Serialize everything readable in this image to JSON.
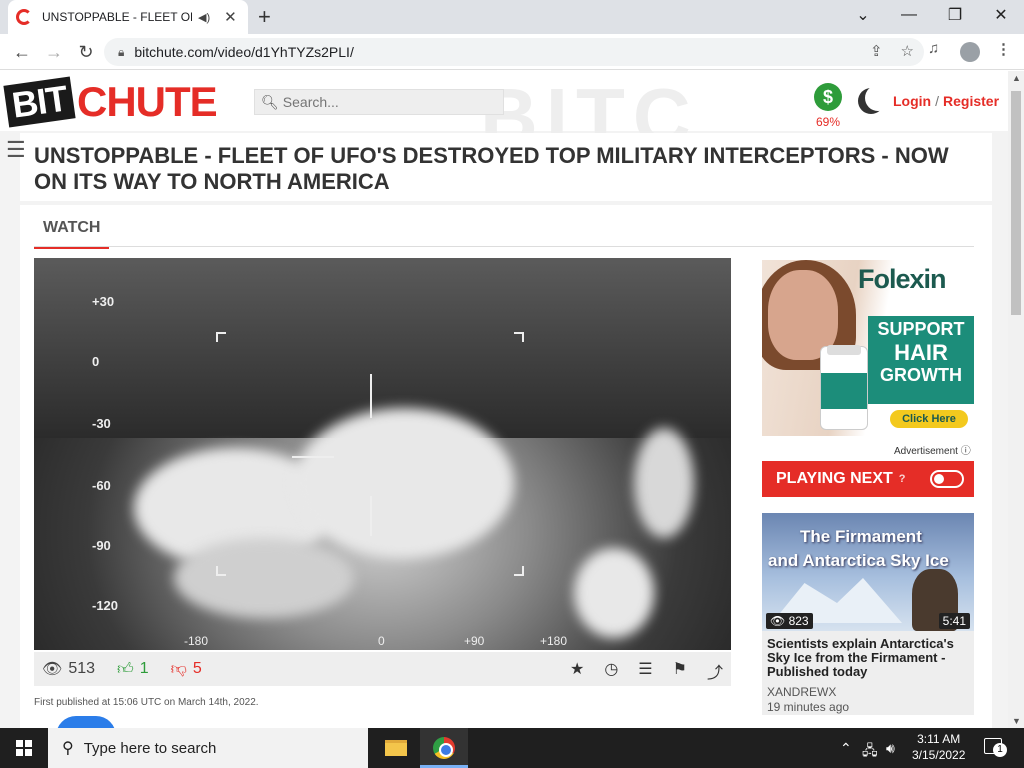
{
  "browser": {
    "tab_title": "UNSTOPPABLE - FLEET OF U",
    "url": "bitchute.com/video/d1YhTYZs2PLI/",
    "new_tab_symbol": "+",
    "close_symbol": "✕",
    "minimize_symbol": "—",
    "maximize_symbol": "❐",
    "window_close_symbol": "✕"
  },
  "site": {
    "logo_part1": "BIT",
    "logo_part2": "CHUTE",
    "header_deco": "BITC",
    "search_placeholder": "Search...",
    "donate_symbol": "$",
    "donate_percent": "69%",
    "login_label": "Login",
    "separator": "/",
    "register_label": "Register"
  },
  "video": {
    "title": "UNSTOPPABLE - FLEET OF UFO'S DESTROYED TOP MILITARY INTERCEPTORS - NOW ON ITS WAY TO NORTH AMERICA",
    "watch_tab": "WATCH",
    "views": "513",
    "likes": "1",
    "dislikes": "5",
    "published": "First published at 15:06 UTC on March 14th, 2022.",
    "hud_scale": [
      "+30",
      "0",
      "-30",
      "-60",
      "-90",
      "-120"
    ],
    "hud_xscale": [
      "-180",
      "0",
      "+90",
      "+180"
    ]
  },
  "ad": {
    "brand": "Folexin",
    "line1": "SUPPORT",
    "line2": "HAIR",
    "line3": "GROWTH",
    "cta": "Click Here",
    "label": "Advertisement"
  },
  "sidebar": {
    "playing_next": "PLAYING NEXT",
    "next": {
      "thumb_line1": "The Firmament",
      "thumb_line2": "and Antarctica Sky Ice",
      "views": "823",
      "duration": "5:41",
      "title": "Scientists explain Antarctica's Sky Ice from the Firmament - Published today",
      "author": "XANDREWX",
      "time": "19 minutes ago"
    }
  },
  "taskbar": {
    "search_placeholder": "Type here to search",
    "time": "3:11 AM",
    "date": "3/15/2022",
    "notifications": "1"
  },
  "colors": {
    "accent": "#e52d27",
    "donate_green": "#2e9c3a",
    "like_green": "#2e9c3a"
  }
}
